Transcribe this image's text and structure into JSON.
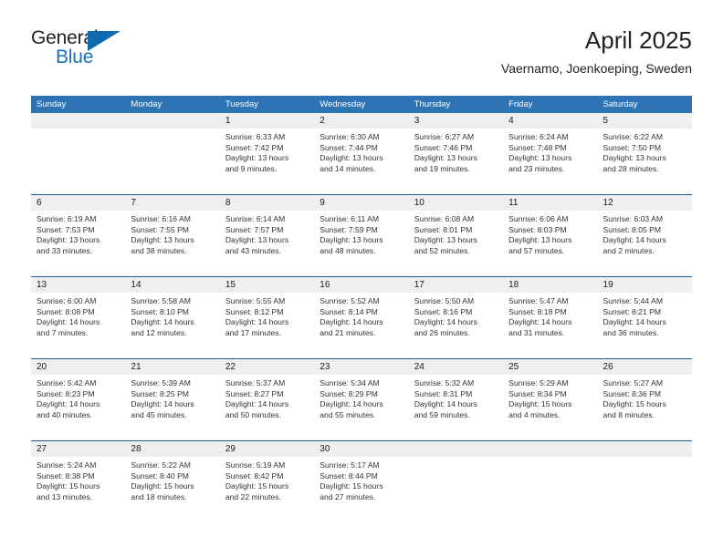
{
  "brand": {
    "name_part1": "General",
    "name_part2": "Blue",
    "triangle_icon": "brand-triangle-icon",
    "accent_color": "#1d70b8"
  },
  "header": {
    "title": "April 2025",
    "subtitle": "Vaernamo, Joenkoeping, Sweden"
  },
  "theme": {
    "header_blue": "#2e74b5",
    "row_divider_blue": "#1f5d9c",
    "daynum_band_gray": "#efefef",
    "text_color": "#333333"
  },
  "calendar": {
    "weekdays": [
      "Sunday",
      "Monday",
      "Tuesday",
      "Wednesday",
      "Thursday",
      "Friday",
      "Saturday"
    ],
    "weeks": [
      [
        {
          "day": "",
          "sunrise": "",
          "sunset": "",
          "daylight_line1": "",
          "daylight_line2": ""
        },
        {
          "day": "",
          "sunrise": "",
          "sunset": "",
          "daylight_line1": "",
          "daylight_line2": ""
        },
        {
          "day": "1",
          "sunrise": "Sunrise: 6:33 AM",
          "sunset": "Sunset: 7:42 PM",
          "daylight_line1": "Daylight: 13 hours",
          "daylight_line2": "and 9 minutes."
        },
        {
          "day": "2",
          "sunrise": "Sunrise: 6:30 AM",
          "sunset": "Sunset: 7:44 PM",
          "daylight_line1": "Daylight: 13 hours",
          "daylight_line2": "and 14 minutes."
        },
        {
          "day": "3",
          "sunrise": "Sunrise: 6:27 AM",
          "sunset": "Sunset: 7:46 PM",
          "daylight_line1": "Daylight: 13 hours",
          "daylight_line2": "and 19 minutes."
        },
        {
          "day": "4",
          "sunrise": "Sunrise: 6:24 AM",
          "sunset": "Sunset: 7:48 PM",
          "daylight_line1": "Daylight: 13 hours",
          "daylight_line2": "and 23 minutes."
        },
        {
          "day": "5",
          "sunrise": "Sunrise: 6:22 AM",
          "sunset": "Sunset: 7:50 PM",
          "daylight_line1": "Daylight: 13 hours",
          "daylight_line2": "and 28 minutes."
        }
      ],
      [
        {
          "day": "6",
          "sunrise": "Sunrise: 6:19 AM",
          "sunset": "Sunset: 7:53 PM",
          "daylight_line1": "Daylight: 13 hours",
          "daylight_line2": "and 33 minutes."
        },
        {
          "day": "7",
          "sunrise": "Sunrise: 6:16 AM",
          "sunset": "Sunset: 7:55 PM",
          "daylight_line1": "Daylight: 13 hours",
          "daylight_line2": "and 38 minutes."
        },
        {
          "day": "8",
          "sunrise": "Sunrise: 6:14 AM",
          "sunset": "Sunset: 7:57 PM",
          "daylight_line1": "Daylight: 13 hours",
          "daylight_line2": "and 43 minutes."
        },
        {
          "day": "9",
          "sunrise": "Sunrise: 6:11 AM",
          "sunset": "Sunset: 7:59 PM",
          "daylight_line1": "Daylight: 13 hours",
          "daylight_line2": "and 48 minutes."
        },
        {
          "day": "10",
          "sunrise": "Sunrise: 6:08 AM",
          "sunset": "Sunset: 8:01 PM",
          "daylight_line1": "Daylight: 13 hours",
          "daylight_line2": "and 52 minutes."
        },
        {
          "day": "11",
          "sunrise": "Sunrise: 6:06 AM",
          "sunset": "Sunset: 8:03 PM",
          "daylight_line1": "Daylight: 13 hours",
          "daylight_line2": "and 57 minutes."
        },
        {
          "day": "12",
          "sunrise": "Sunrise: 6:03 AM",
          "sunset": "Sunset: 8:05 PM",
          "daylight_line1": "Daylight: 14 hours",
          "daylight_line2": "and 2 minutes."
        }
      ],
      [
        {
          "day": "13",
          "sunrise": "Sunrise: 6:00 AM",
          "sunset": "Sunset: 8:08 PM",
          "daylight_line1": "Daylight: 14 hours",
          "daylight_line2": "and 7 minutes."
        },
        {
          "day": "14",
          "sunrise": "Sunrise: 5:58 AM",
          "sunset": "Sunset: 8:10 PM",
          "daylight_line1": "Daylight: 14 hours",
          "daylight_line2": "and 12 minutes."
        },
        {
          "day": "15",
          "sunrise": "Sunrise: 5:55 AM",
          "sunset": "Sunset: 8:12 PM",
          "daylight_line1": "Daylight: 14 hours",
          "daylight_line2": "and 17 minutes."
        },
        {
          "day": "16",
          "sunrise": "Sunrise: 5:52 AM",
          "sunset": "Sunset: 8:14 PM",
          "daylight_line1": "Daylight: 14 hours",
          "daylight_line2": "and 21 minutes."
        },
        {
          "day": "17",
          "sunrise": "Sunrise: 5:50 AM",
          "sunset": "Sunset: 8:16 PM",
          "daylight_line1": "Daylight: 14 hours",
          "daylight_line2": "and 26 minutes."
        },
        {
          "day": "18",
          "sunrise": "Sunrise: 5:47 AM",
          "sunset": "Sunset: 8:18 PM",
          "daylight_line1": "Daylight: 14 hours",
          "daylight_line2": "and 31 minutes."
        },
        {
          "day": "19",
          "sunrise": "Sunrise: 5:44 AM",
          "sunset": "Sunset: 8:21 PM",
          "daylight_line1": "Daylight: 14 hours",
          "daylight_line2": "and 36 minutes."
        }
      ],
      [
        {
          "day": "20",
          "sunrise": "Sunrise: 5:42 AM",
          "sunset": "Sunset: 8:23 PM",
          "daylight_line1": "Daylight: 14 hours",
          "daylight_line2": "and 40 minutes."
        },
        {
          "day": "21",
          "sunrise": "Sunrise: 5:39 AM",
          "sunset": "Sunset: 8:25 PM",
          "daylight_line1": "Daylight: 14 hours",
          "daylight_line2": "and 45 minutes."
        },
        {
          "day": "22",
          "sunrise": "Sunrise: 5:37 AM",
          "sunset": "Sunset: 8:27 PM",
          "daylight_line1": "Daylight: 14 hours",
          "daylight_line2": "and 50 minutes."
        },
        {
          "day": "23",
          "sunrise": "Sunrise: 5:34 AM",
          "sunset": "Sunset: 8:29 PM",
          "daylight_line1": "Daylight: 14 hours",
          "daylight_line2": "and 55 minutes."
        },
        {
          "day": "24",
          "sunrise": "Sunrise: 5:32 AM",
          "sunset": "Sunset: 8:31 PM",
          "daylight_line1": "Daylight: 14 hours",
          "daylight_line2": "and 59 minutes."
        },
        {
          "day": "25",
          "sunrise": "Sunrise: 5:29 AM",
          "sunset": "Sunset: 8:34 PM",
          "daylight_line1": "Daylight: 15 hours",
          "daylight_line2": "and 4 minutes."
        },
        {
          "day": "26",
          "sunrise": "Sunrise: 5:27 AM",
          "sunset": "Sunset: 8:36 PM",
          "daylight_line1": "Daylight: 15 hours",
          "daylight_line2": "and 8 minutes."
        }
      ],
      [
        {
          "day": "27",
          "sunrise": "Sunrise: 5:24 AM",
          "sunset": "Sunset: 8:38 PM",
          "daylight_line1": "Daylight: 15 hours",
          "daylight_line2": "and 13 minutes."
        },
        {
          "day": "28",
          "sunrise": "Sunrise: 5:22 AM",
          "sunset": "Sunset: 8:40 PM",
          "daylight_line1": "Daylight: 15 hours",
          "daylight_line2": "and 18 minutes."
        },
        {
          "day": "29",
          "sunrise": "Sunrise: 5:19 AM",
          "sunset": "Sunset: 8:42 PM",
          "daylight_line1": "Daylight: 15 hours",
          "daylight_line2": "and 22 minutes."
        },
        {
          "day": "30",
          "sunrise": "Sunrise: 5:17 AM",
          "sunset": "Sunset: 8:44 PM",
          "daylight_line1": "Daylight: 15 hours",
          "daylight_line2": "and 27 minutes."
        },
        {
          "day": "",
          "sunrise": "",
          "sunset": "",
          "daylight_line1": "",
          "daylight_line2": ""
        },
        {
          "day": "",
          "sunrise": "",
          "sunset": "",
          "daylight_line1": "",
          "daylight_line2": ""
        },
        {
          "day": "",
          "sunrise": "",
          "sunset": "",
          "daylight_line1": "",
          "daylight_line2": ""
        }
      ]
    ]
  }
}
